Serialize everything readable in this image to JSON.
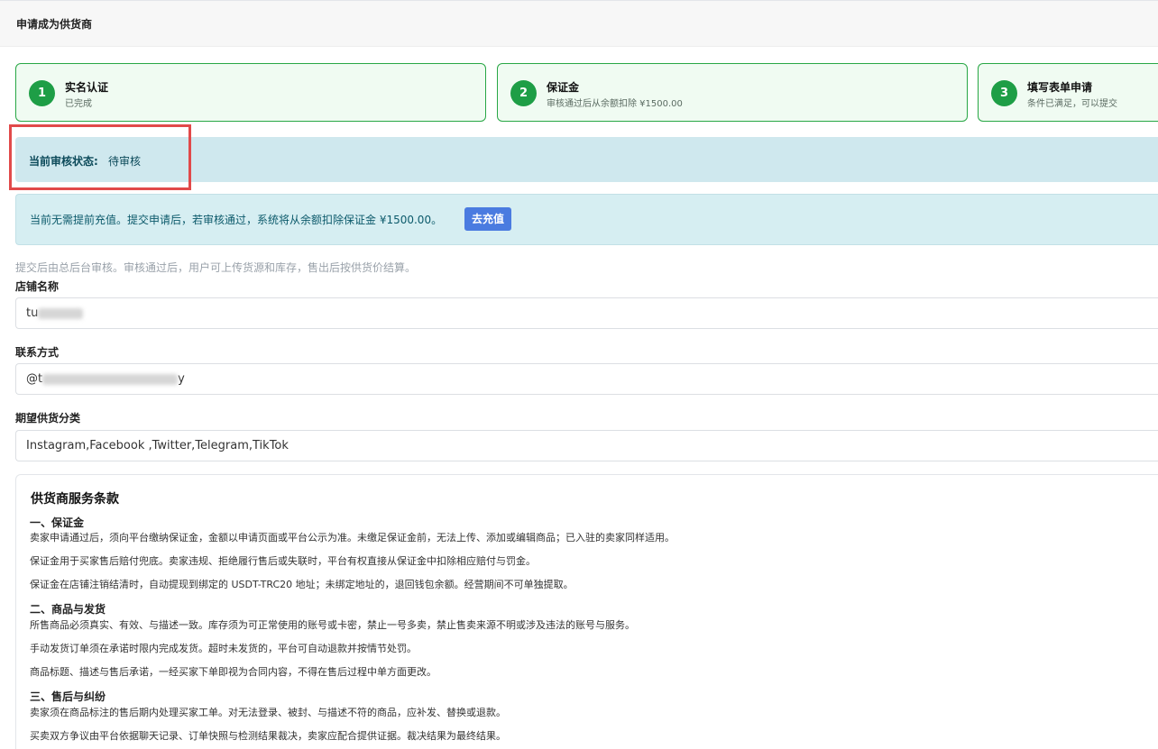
{
  "header": {
    "title": "申请成为供货商"
  },
  "steps": [
    {
      "number": "1",
      "title": "实名认证",
      "subtitle": "已完成"
    },
    {
      "number": "2",
      "title": "保证金",
      "subtitle": "审核通过后从余额扣除 ¥1500.00"
    },
    {
      "number": "3",
      "title": "填写表单申请",
      "subtitle": "条件已满足，可以提交"
    }
  ],
  "status": {
    "label": "当前审核状态:",
    "value": "待审核"
  },
  "notice": {
    "text": "当前无需提前充值。提交申请后，若审核通过，系统将从余额扣除保证金 ¥1500.00。",
    "button": "去充值"
  },
  "hint": "提交后由总后台审核。审核通过后，用户可上传货源和库存，售出后按供货价结算。",
  "form": {
    "store_name": {
      "label": "店铺名称",
      "value_prefix": "tu"
    },
    "contact": {
      "label": "联系方式",
      "value_prefix": "@t",
      "value_suffix": "y"
    },
    "category": {
      "label": "期望供货分类",
      "value": "Instagram,Facebook ,Twitter,Telegram,TikTok"
    }
  },
  "terms": {
    "title": "供货商服务条款",
    "sections": [
      {
        "title": "一、保证金",
        "paragraphs": [
          "卖家申请通过后，须向平台缴纳保证金，金额以申请页面或平台公示为准。未缴足保证金前，无法上传、添加或编辑商品；已入驻的卖家同样适用。",
          "保证金用于买家售后赔付兜底。卖家违规、拒绝履行售后或失联时，平台有权直接从保证金中扣除相应赔付与罚金。",
          "保证金在店铺注销结清时，自动提现到绑定的 USDT-TRC20 地址；未绑定地址的，退回钱包余额。经营期间不可单独提取。"
        ]
      },
      {
        "title": "二、商品与发货",
        "paragraphs": [
          "所售商品必须真实、有效、与描述一致。库存须为可正常使用的账号或卡密，禁止一号多卖，禁止售卖来源不明或涉及违法的账号与服务。",
          "手动发货订单须在承诺时限内完成发货。超时未发货的，平台可自动退款并按情节处罚。",
          "商品标题、描述与售后承诺，一经买家下单即视为合同内容，不得在售后过程中单方面更改。"
        ]
      },
      {
        "title": "三、售后与纠纷",
        "paragraphs": [
          "卖家须在商品标注的售后期内处理买家工单。对无法登录、被封、与描述不符的商品，应补发、替换或退款。",
          "买卖双方争议由平台依据聊天记录、订单快照与检测结果裁决，卖家应配合提供证据。裁决结果为最终结果。"
        ]
      }
    ]
  },
  "colors": {
    "step_border": "#28a745",
    "step_circle": "#1e9e46",
    "status_bg": "#cfe8ee",
    "button": "#4a7be0",
    "highlight": "#e14a4a"
  }
}
